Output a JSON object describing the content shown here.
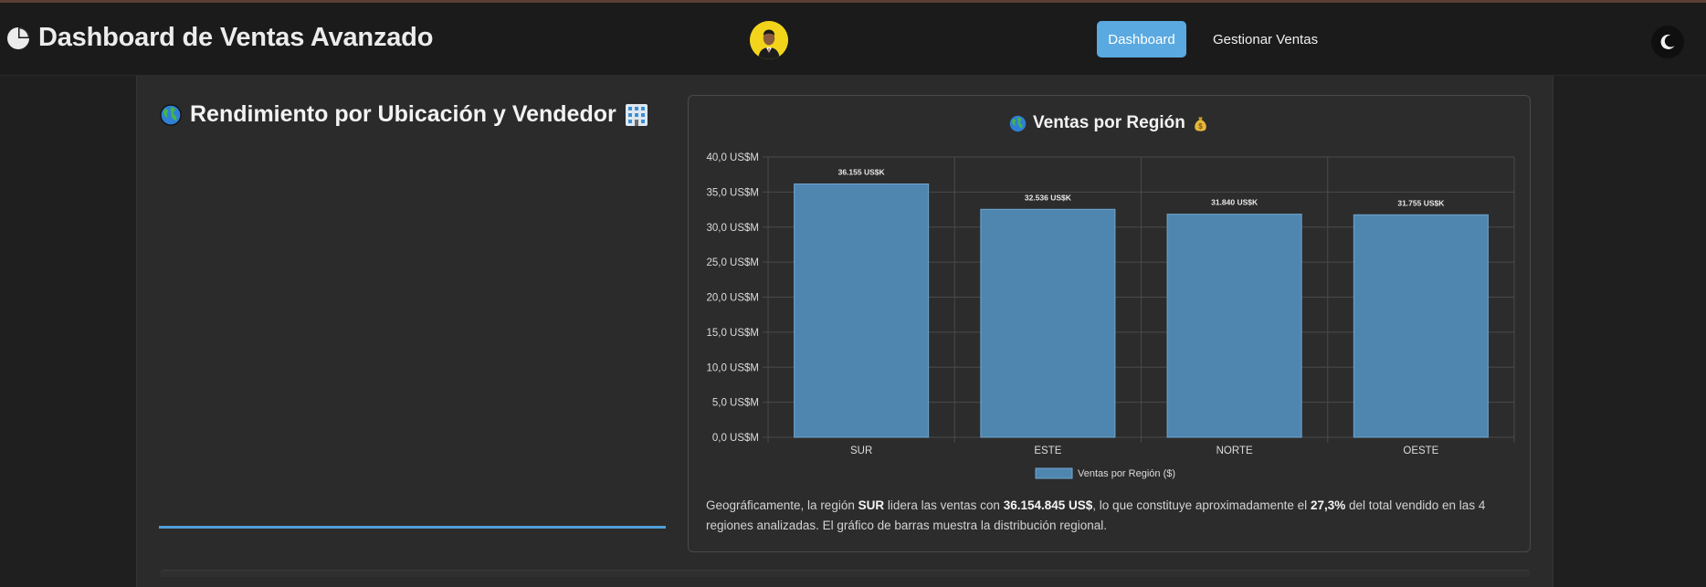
{
  "navbar": {
    "title": "Dashboard de Ventas Avanzado",
    "nav_items": [
      {
        "label": "Dashboard",
        "active": true
      },
      {
        "label": "Gestionar Ventas",
        "active": false
      }
    ],
    "accent_color": "#5aa9e0",
    "icons": {
      "brand": "pie-chart-icon",
      "theme": "moon-icon",
      "avatar": "user-avatar"
    }
  },
  "left_panel": {
    "title": "Rendimiento por Ubicación y Vendedor",
    "icons": [
      "globe-icon",
      "office-building-icon"
    ]
  },
  "chart_panel": {
    "title": "Ventas por Región",
    "icons": [
      "globe-icon",
      "money-bag-icon"
    ]
  },
  "chart_data": {
    "type": "bar",
    "title": "Ventas por Región",
    "categories": [
      "SUR",
      "ESTE",
      "NORTE",
      "OESTE"
    ],
    "series": [
      {
        "name": "Ventas por Región ($)",
        "values": [
          36.155,
          32.536,
          31.84,
          31.755
        ],
        "color": "#4f86b0"
      }
    ],
    "data_labels": [
      "36.155 US$K",
      "32.536 US$K",
      "31.840 US$K",
      "31.755 US$K"
    ],
    "y_ticks": [
      "0,0 US$M",
      "5,0 US$M",
      "10,0 US$M",
      "15,0 US$M",
      "20,0 US$M",
      "25,0 US$M",
      "30,0 US$M",
      "35,0 US$M",
      "40,0 US$M"
    ],
    "ylim": [
      0,
      40
    ],
    "xlabel": "",
    "ylabel": "",
    "grid": true,
    "legend": "bottom"
  },
  "description": {
    "p1": "Geográficamente, la región ",
    "region": "SUR",
    "p2": " lidera las ventas con ",
    "amount": "36.154.845 US$",
    "p3": ", lo que constituye aproximadamente el ",
    "percent": "27,3%",
    "p4": " del total vendido en las 4 regiones analizadas. El gráfico de barras muestra la distribución regional."
  }
}
